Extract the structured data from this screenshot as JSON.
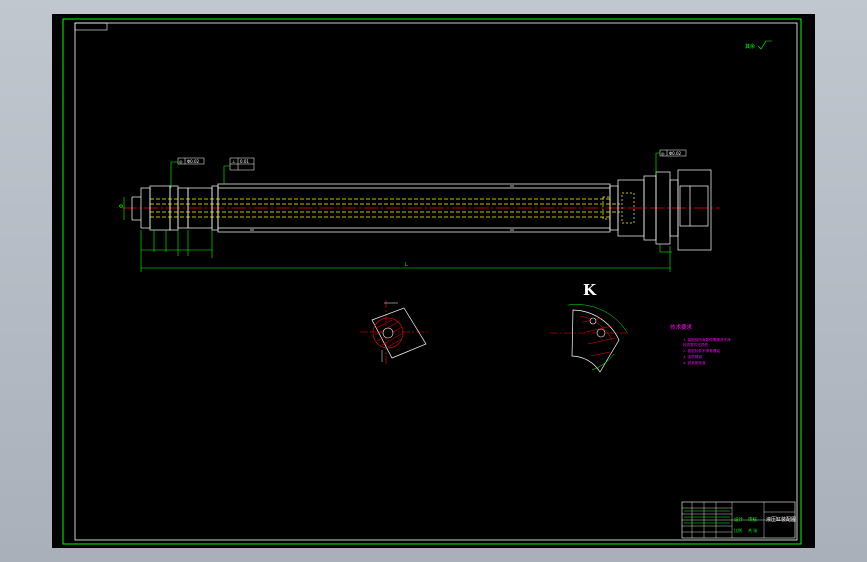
{
  "drawing": {
    "corner_mark": "Ra",
    "roughness_note": "其余",
    "view_label": "K",
    "overall_dim": "L",
    "left_dim": "Φ",
    "tolerance_frames": [
      {
        "symbol": "◎",
        "value": "Φ0.02"
      },
      {
        "symbol": "⊥",
        "value": "0.01"
      },
      {
        "symbol": "◎",
        "value": "Φ0.02"
      }
    ],
    "tech_requirements": {
      "title": "技术要求",
      "items": [
        "1. 装配前所有零件需清洗干净",
        "   检查零件无损伤",
        "2. 各密封件不得有漏油",
        "3. 涂防锈油",
        "4. 其余按标准"
      ]
    },
    "title_block": {
      "name": "液压缸装配图",
      "label_design": "设计",
      "label_check": "审核",
      "label_scale": "比例",
      "label_sheet": "共 张"
    }
  },
  "colors": {
    "background": "#000000",
    "viewport": "#b5bcc5",
    "frame": "#00ff00",
    "outline": "#ffffff",
    "centerline": "#ff0000",
    "hidden": "#ffff00",
    "annotation": "#ff00ff",
    "hatch": "#ff0000"
  }
}
